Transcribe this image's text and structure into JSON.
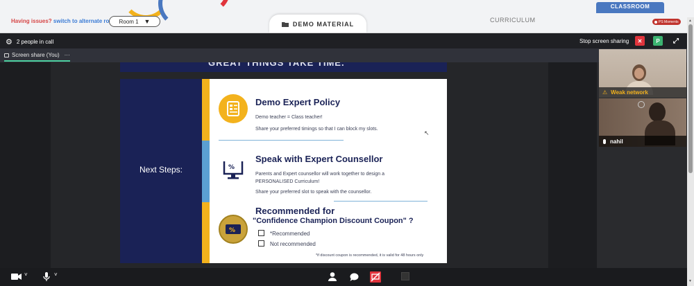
{
  "topbar": {
    "issue_prefix": "Having issues?",
    "issue_link": "switch to alternate room",
    "room_label": "Room 1",
    "demo_tab": "DEMO MATERIAL",
    "curriculum_tab": "CURRICULUM",
    "classroom_tab": "CLASSROOM",
    "moments_badge": "PS Moments"
  },
  "callbar": {
    "people_count": "2 people in call",
    "stop_sharing": "Stop screen sharing",
    "participant_initial": "P"
  },
  "tabbar": {
    "screen_share_tab": "Screen share (You)",
    "more": "···"
  },
  "slide": {
    "top_text": "GREAT THINGS TAKE TIME.",
    "next_steps": "Next Steps:",
    "sections": [
      {
        "title": "Demo Expert Policy",
        "lines": [
          "Demo teacher = Class teacher!",
          "Share your preferred timings so that I can block my slots."
        ]
      },
      {
        "title": "Speak with Expert Counsellor",
        "lines": [
          "Parents and Expert counsellor will work together to design a",
          "PERSONALISED Curriculum!",
          "Share your preferred slot to speak with the counsellor."
        ]
      },
      {
        "title": "Recommended for",
        "subtitle": "\"Confidence Champion Discount Coupon\" ?",
        "options": [
          "*Recommended",
          "Not recommended"
        ],
        "footnote": "*if discount coupon is recommended, it is valid for 48 hours only"
      }
    ],
    "colors": {
      "navy": "#1a2256",
      "yellow": "#f3b21d",
      "blue": "#5b9fd3"
    }
  },
  "videos": {
    "tile1_warning": "Weak network",
    "tile2_name": "nahil"
  },
  "colors": {
    "accent_green": "#4dd0a0",
    "stop_red": "#e0343c",
    "participant_green": "#3cb371"
  }
}
